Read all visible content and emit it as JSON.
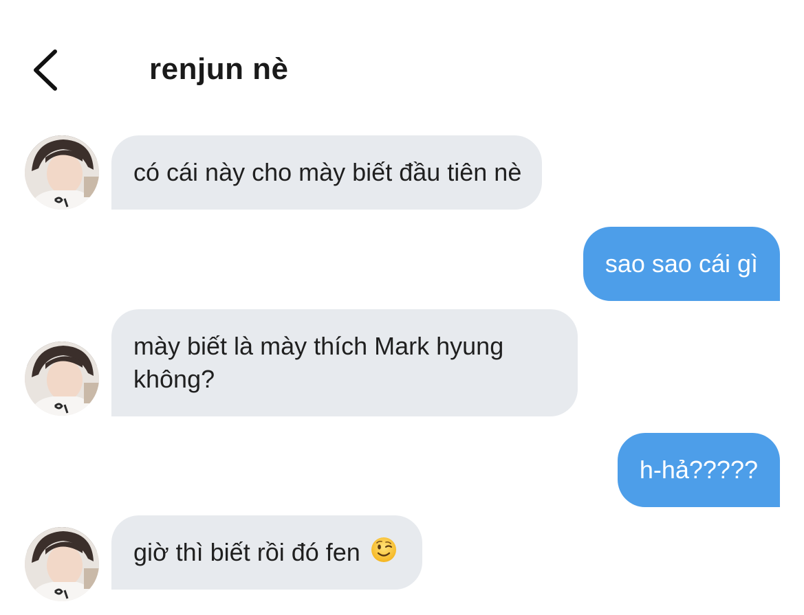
{
  "header": {
    "back_icon": "chevron-left-icon",
    "contact_name": "renjun nè"
  },
  "messages": [
    {
      "direction": "in",
      "text": "có cái này cho mày biết đầu tiên nè"
    },
    {
      "direction": "out",
      "text": "sao sao cái gì"
    },
    {
      "direction": "in",
      "lines": [
        "mày biết là mày thích Mark hyung",
        "không?"
      ]
    },
    {
      "direction": "out",
      "text": "h-hả?????"
    },
    {
      "direction": "in",
      "text": "giờ thì biết rồi đó fen",
      "emoji": "winking-face-emoji"
    }
  ],
  "colors": {
    "incoming_bubble": "#e7eaee",
    "outgoing_bubble": "#4d9ee9",
    "outgoing_text": "#ffffff",
    "background": "#ffffff"
  }
}
